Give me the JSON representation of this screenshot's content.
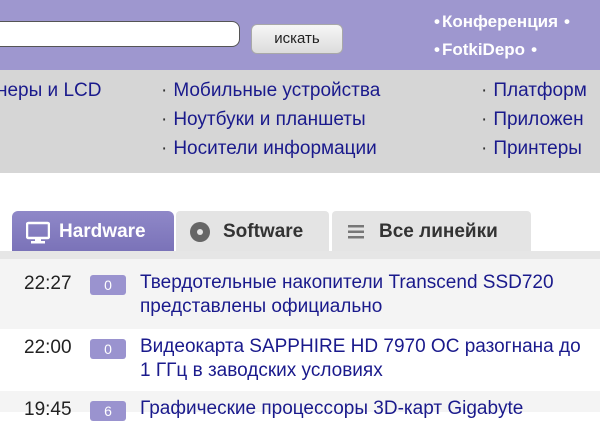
{
  "header": {
    "search_button": "искать",
    "links": [
      "Конференция",
      "FotkiDepo"
    ],
    "bullet": "•"
  },
  "categories": {
    "bullet": "·",
    "col1": [
      "неры и LCD"
    ],
    "col2": [
      "Мобильные устройства",
      "Ноутбуки и планшеты",
      "Носители информации"
    ],
    "col3": [
      "Платформ",
      "Приложен",
      "Принтеры"
    ]
  },
  "tabs": [
    {
      "label": "Hardware",
      "icon": "monitor-icon",
      "active": true
    },
    {
      "label": "Software",
      "icon": "disc-icon",
      "active": false
    },
    {
      "label": "Все линейки",
      "icon": "list-icon",
      "active": false
    }
  ],
  "news": [
    {
      "time": "22:27",
      "comments": "0",
      "title": "Твердотельные накопители Transcend SSD720 представлены официально"
    },
    {
      "time": "22:00",
      "comments": "0",
      "title": "Видеокарта SAPPHIRE HD 7970 OC разогнана до 1 ГГц в заводских условиях"
    },
    {
      "time": "19:45",
      "comments": "6",
      "title": "Графические процессоры 3D-карт Gigabyte"
    }
  ],
  "colors": {
    "accent": "#9e97cf",
    "link": "#1a1a8c",
    "catbar": "#d6d6d6"
  }
}
